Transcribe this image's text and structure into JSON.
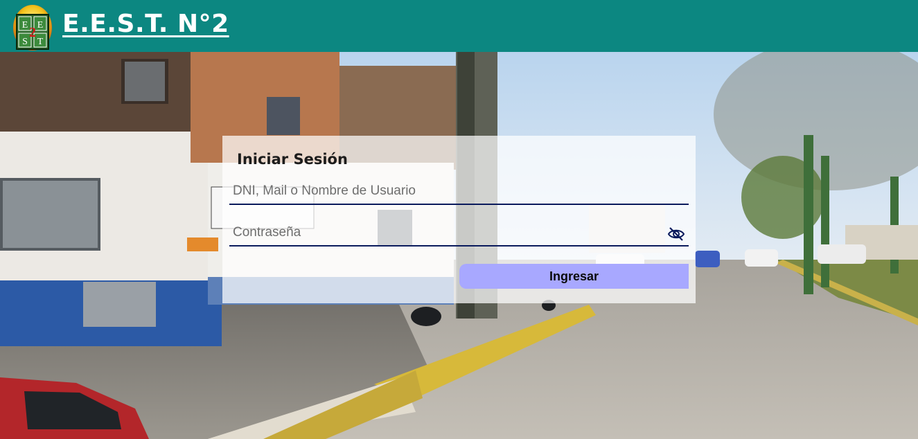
{
  "header": {
    "title": "E.E.S.T. N°2",
    "logo_letters": [
      "E",
      "E",
      "S",
      "T"
    ],
    "logo_number": "2",
    "background_color": "#0c8781"
  },
  "login": {
    "title": "Iniciar Sesión",
    "username_placeholder": "DNI, Mail o Nombre de Usuario",
    "password_placeholder": "Contraseña",
    "password_toggle_icon": "eye-slash-icon",
    "submit_label": "Ingresar",
    "accent_color": "#a8a8ff"
  }
}
